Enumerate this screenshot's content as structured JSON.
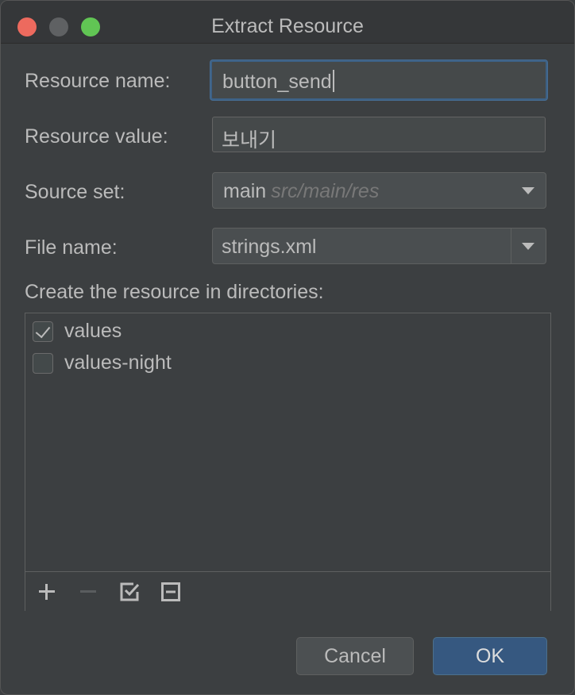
{
  "window": {
    "title": "Extract Resource"
  },
  "form": {
    "resource_name_label": "Resource name:",
    "resource_name_value": "button_send",
    "resource_value_label": "Resource value:",
    "resource_value_value": "보내기",
    "source_set_label": "Source set:",
    "source_set_value": "main",
    "source_set_hint": "src/main/res",
    "file_name_label": "File name:",
    "file_name_value": "strings.xml"
  },
  "directories": {
    "label": "Create the resource in directories:",
    "items": [
      {
        "label": "values",
        "checked": true
      },
      {
        "label": "values-night",
        "checked": false
      }
    ],
    "toolbar": [
      "add-icon",
      "remove-icon",
      "select-all-icon",
      "unselect-all-icon"
    ]
  },
  "buttons": {
    "cancel": "Cancel",
    "ok": "OK"
  },
  "colors": {
    "ok_button": "#365880",
    "focus_ring": "#3d6185",
    "close": "#ed6a5e",
    "zoom": "#61c554"
  }
}
